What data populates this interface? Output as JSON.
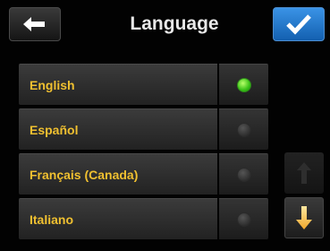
{
  "header": {
    "title": "Language",
    "back_icon": "arrow-left-icon",
    "confirm_icon": "checkmark-icon",
    "confirm_color": "#1e78d0"
  },
  "languages": [
    {
      "label": "English",
      "selected": true
    },
    {
      "label": "Español",
      "selected": false
    },
    {
      "label": "Français (Canada)",
      "selected": false
    },
    {
      "label": "Italiano",
      "selected": false
    }
  ],
  "colors": {
    "label_text": "#f0c030",
    "radio_selected": "#39c217",
    "title_text": "#e8e8e8"
  },
  "scroll": {
    "up_icon": "arrow-up-icon",
    "down_icon": "arrow-down-icon",
    "up_enabled": false,
    "down_enabled": true
  }
}
